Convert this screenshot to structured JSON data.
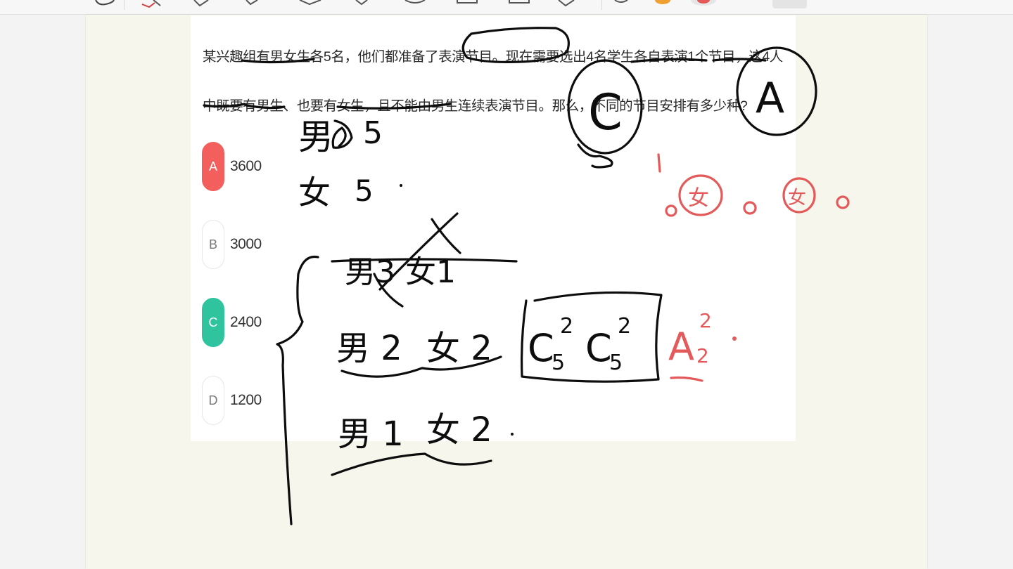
{
  "toolbar": {
    "tools": [
      {
        "name": "lasso-tool-icon"
      },
      {
        "name": "pen-tool-icon"
      },
      {
        "name": "eraser-tool-icon"
      },
      {
        "name": "highlighter-tool-icon"
      },
      {
        "name": "shape-tool-icon"
      },
      {
        "name": "text-tool-icon"
      },
      {
        "name": "sticker-tool-icon"
      },
      {
        "name": "image-tool-icon"
      },
      {
        "name": "ruler-tool-icon"
      },
      {
        "name": "undo-tool-icon"
      },
      {
        "name": "color-orange-swatch"
      },
      {
        "name": "color-red-swatch"
      }
    ],
    "colors": {
      "orange": "#f0a030",
      "red": "#e45a5a"
    }
  },
  "question": {
    "text": "某兴趣组有男女生各5名，他们都准备了表演节目。现在需要选出4名学生各自表演1个节目，这4人中既要有男生、也要有女生，且不能由男生连续表演节目。那么，不同的节目安排有多少种?",
    "options": [
      {
        "letter": "A",
        "value": "3600",
        "state": "wrong"
      },
      {
        "letter": "B",
        "value": "3000",
        "state": "normal"
      },
      {
        "letter": "C",
        "value": "2400",
        "state": "correct"
      },
      {
        "letter": "D",
        "value": "1200",
        "state": "normal"
      }
    ],
    "colors": {
      "wrong": "#f25f5c",
      "correct": "#2fc49d"
    }
  },
  "handwriting": {
    "boys_label": "男",
    "boys_count": "5",
    "girls_label": "女",
    "girls_count": "5",
    "struck_case": "男3 女1",
    "case_two": {
      "boys": "男 2",
      "girls": "女 2"
    },
    "case_one": {
      "boys": "男 1",
      "girls": "女 2"
    },
    "combination_c": "C",
    "combination_sup": "2",
    "combination_sub": "5",
    "arrangement_a": "A",
    "arrangement_sup": "2",
    "arrangement_sub": "2",
    "circle_c": "C",
    "circle_a": "A",
    "slot_char": "女",
    "ink_colors": {
      "black": "#0d0d0d",
      "red": "#e45a5a"
    }
  }
}
